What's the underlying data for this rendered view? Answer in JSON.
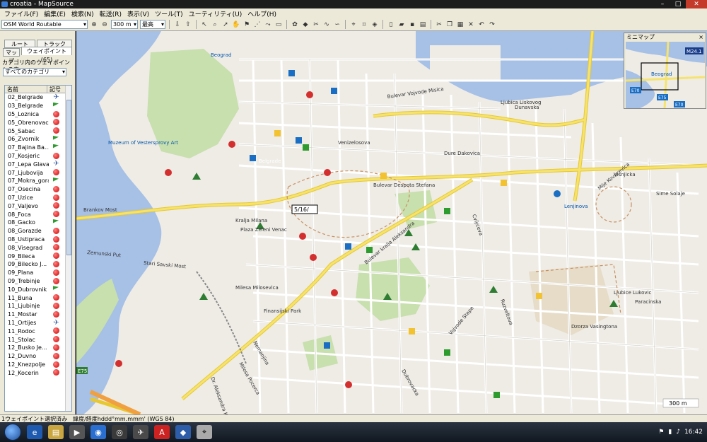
{
  "window": {
    "title": "croatia - MapSource"
  },
  "menu": [
    "ファイル(F)",
    "編集(E)",
    "検索(N)",
    "転送(R)",
    "表示(V)",
    "ツール(T)",
    "ユーティリティ(U)",
    "ヘルプ(H)"
  ],
  "toolbar": {
    "map_product": "OSM World Routable",
    "zoom_scale": "300 m",
    "detail": "最高"
  },
  "left_panel": {
    "tabs": [
      "ルート",
      "トラック",
      "マップ",
      "ウェイポイント (65)"
    ],
    "category_label": "カテゴリ内のウェイポイントの表",
    "category_value": "すべてのカテゴリ",
    "col_name": "名前",
    "col_symbol": "記号",
    "waypoints": [
      {
        "name": "02_Belgrade",
        "sym": "plane"
      },
      {
        "name": "03_Belgrade",
        "sym": "flag"
      },
      {
        "name": "05_Loznica",
        "sym": "pin"
      },
      {
        "name": "05_Obrenovac",
        "sym": "pin"
      },
      {
        "name": "05_Sabac",
        "sym": "pin"
      },
      {
        "name": "06_Zvornik",
        "sym": "flag"
      },
      {
        "name": "07_Bajina Ba...",
        "sym": "flag"
      },
      {
        "name": "07_Kosjeric",
        "sym": "pin"
      },
      {
        "name": "07_Lepa Glava",
        "sym": "plane"
      },
      {
        "name": "07_Ljubovija",
        "sym": "pin"
      },
      {
        "name": "07_Mokra_gora",
        "sym": "flag"
      },
      {
        "name": "07_Osecina",
        "sym": "pin"
      },
      {
        "name": "07_Uzice",
        "sym": "pin"
      },
      {
        "name": "07_Valjevo",
        "sym": "pin"
      },
      {
        "name": "08_Foca",
        "sym": "pin"
      },
      {
        "name": "08_Gacko",
        "sym": "flag"
      },
      {
        "name": "08_Gorazde",
        "sym": "pin"
      },
      {
        "name": "08_Ustipraca",
        "sym": "pin"
      },
      {
        "name": "08_Visegrad",
        "sym": "pin"
      },
      {
        "name": "09_Bileca",
        "sym": "pin"
      },
      {
        "name": "09_Bilecko J...",
        "sym": "pin"
      },
      {
        "name": "09_Plana",
        "sym": "pin"
      },
      {
        "name": "09_Trebinje",
        "sym": "pin"
      },
      {
        "name": "10_Dubrovnik",
        "sym": "flag"
      },
      {
        "name": "11_Buna",
        "sym": "pin"
      },
      {
        "name": "11_Ljubinje",
        "sym": "pin"
      },
      {
        "name": "11_Mostar",
        "sym": "pin"
      },
      {
        "name": "11_Ortijes",
        "sym": "plane"
      },
      {
        "name": "11_Rodoc",
        "sym": "pin"
      },
      {
        "name": "11_Stolac",
        "sym": "pin"
      },
      {
        "name": "12_Busko Je...",
        "sym": "pin"
      },
      {
        "name": "12_Duvno",
        "sym": "pin"
      },
      {
        "name": "12_Knezpolje",
        "sym": "pin"
      },
      {
        "name": "12_Kocerin",
        "sym": "pin"
      }
    ]
  },
  "map": {
    "streets": [
      "Bulevar Despota Stefana",
      "Bulevar Vojvode Misica",
      "Dunavska",
      "Dure Dakovica",
      "Venizelosova",
      "Visnjicka",
      "Cvijiceva",
      "Ruzveltova",
      "Bulevar kralja Aleksandra",
      "Nemanjina",
      "Milosa Pocerca",
      "Kralja Milana",
      "Dubrovacka",
      "Stari Savski Most",
      "Zemunski Put",
      "Brankov Most",
      "Sime Solaje",
      "Mije Kovacevica",
      "Ljubice Lukovic",
      "Paracinska",
      "Vojvode Stepe",
      "Dr. Aleksandra Kostica",
      "Milesa Milosevica"
    ],
    "places": [
      "Beograd",
      "Belgrade",
      "Plaza Zeleni Venac",
      "Finansijski Park",
      "Muzeum of Vestersprovy Art",
      "Ljubica Liskovog",
      "Lenjinova",
      "Dzorza Vasingtona"
    ],
    "waypoint_label": "5/16/",
    "scale": "300 m",
    "road_shields": [
      "E75",
      "E70"
    ]
  },
  "minimap": {
    "title": "ミニマップ",
    "close": "×",
    "labels": [
      "M24.1",
      "E70",
      "E75",
      "E70"
    ],
    "city": "Beograd"
  },
  "status": {
    "selection": "1ウェイポイント選択済み",
    "format": "緯度/経度hddd°mm.mmm' (WGS 84)"
  },
  "taskbar": {
    "time": "16:42"
  },
  "colors": {
    "water": "#a6c0e6",
    "park": "#c8dfae",
    "road_major": "#f5e36e",
    "road_minor": "#ffffff",
    "land": "#efece6"
  }
}
